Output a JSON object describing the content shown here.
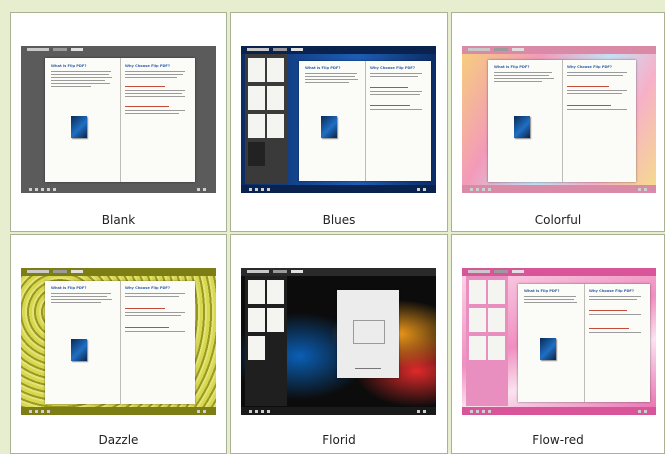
{
  "templates": [
    {
      "label": "Blank",
      "theme": "blank",
      "selected": false,
      "bg": "#5b5b5b",
      "sidebar": false
    },
    {
      "label": "Blues",
      "theme": "blues",
      "selected": false,
      "bg": "#123d7a",
      "sidebar": true
    },
    {
      "label": "Colorful",
      "theme": "colorful",
      "selected": false,
      "bg": "#f0c3d2",
      "sidebar": false
    },
    {
      "label": "Dazzle",
      "theme": "dazzle",
      "selected": false,
      "bg": "#b4b43a",
      "sidebar": false
    },
    {
      "label": "Florid",
      "theme": "florid",
      "selected": false,
      "bg": "#121212",
      "sidebar": true
    },
    {
      "label": "Flow-red",
      "theme": "flow-red",
      "selected": false,
      "bg": "#f2a7cc",
      "sidebar": true
    }
  ],
  "book": {
    "left_title": "What is Flip PDF?",
    "right_title": "Why Choose Flip PDF?"
  },
  "colors": {
    "panel_background": "#e6eecf",
    "cell_border": "#a9b394",
    "heading_blue": "#2f5ea8",
    "heading_red": "#c84a3a"
  }
}
